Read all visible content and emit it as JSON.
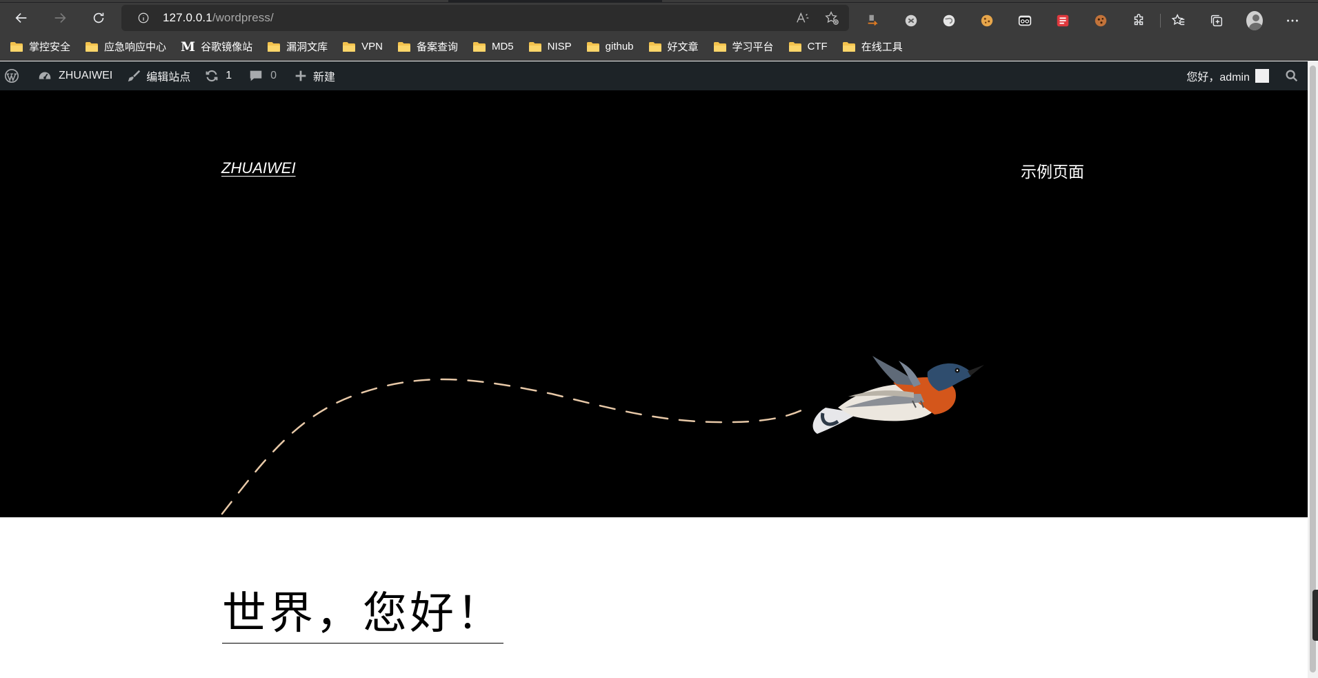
{
  "browser": {
    "url_host": "127.0.0.1",
    "url_path": "/wordpress/",
    "bookmarks": [
      {
        "label": "掌控安全",
        "icon": "folder-icon"
      },
      {
        "label": "应急响应中心",
        "icon": "folder-icon"
      },
      {
        "label": "谷歌镜像站",
        "icon": "m-logo-icon"
      },
      {
        "label": "漏洞文库",
        "icon": "folder-icon"
      },
      {
        "label": "VPN",
        "icon": "folder-icon"
      },
      {
        "label": "备案查询",
        "icon": "folder-icon"
      },
      {
        "label": "MD5",
        "icon": "folder-icon"
      },
      {
        "label": "NISP",
        "icon": "folder-icon"
      },
      {
        "label": "github",
        "icon": "folder-icon"
      },
      {
        "label": "好文章",
        "icon": "folder-icon"
      },
      {
        "label": "学习平台",
        "icon": "folder-icon"
      },
      {
        "label": "CTF",
        "icon": "folder-icon"
      },
      {
        "label": "在线工具",
        "icon": "folder-icon"
      }
    ],
    "m_logo": "M"
  },
  "adminbar": {
    "site_name": "ZHUAIWEI",
    "customize": "编辑站点",
    "updates_count": "1",
    "comments_count": "0",
    "new_label": "新建",
    "greeting": "您好，admin"
  },
  "site": {
    "title": "ZHUAIWEI",
    "nav_page": "示例页面"
  },
  "post": {
    "title": "世界，您好！"
  },
  "colors": {
    "adminbar_bg": "#1d2327",
    "hero_bg": "#000000",
    "chrome_bg": "#3b3b3b",
    "path_color": "#e8c9a8"
  }
}
